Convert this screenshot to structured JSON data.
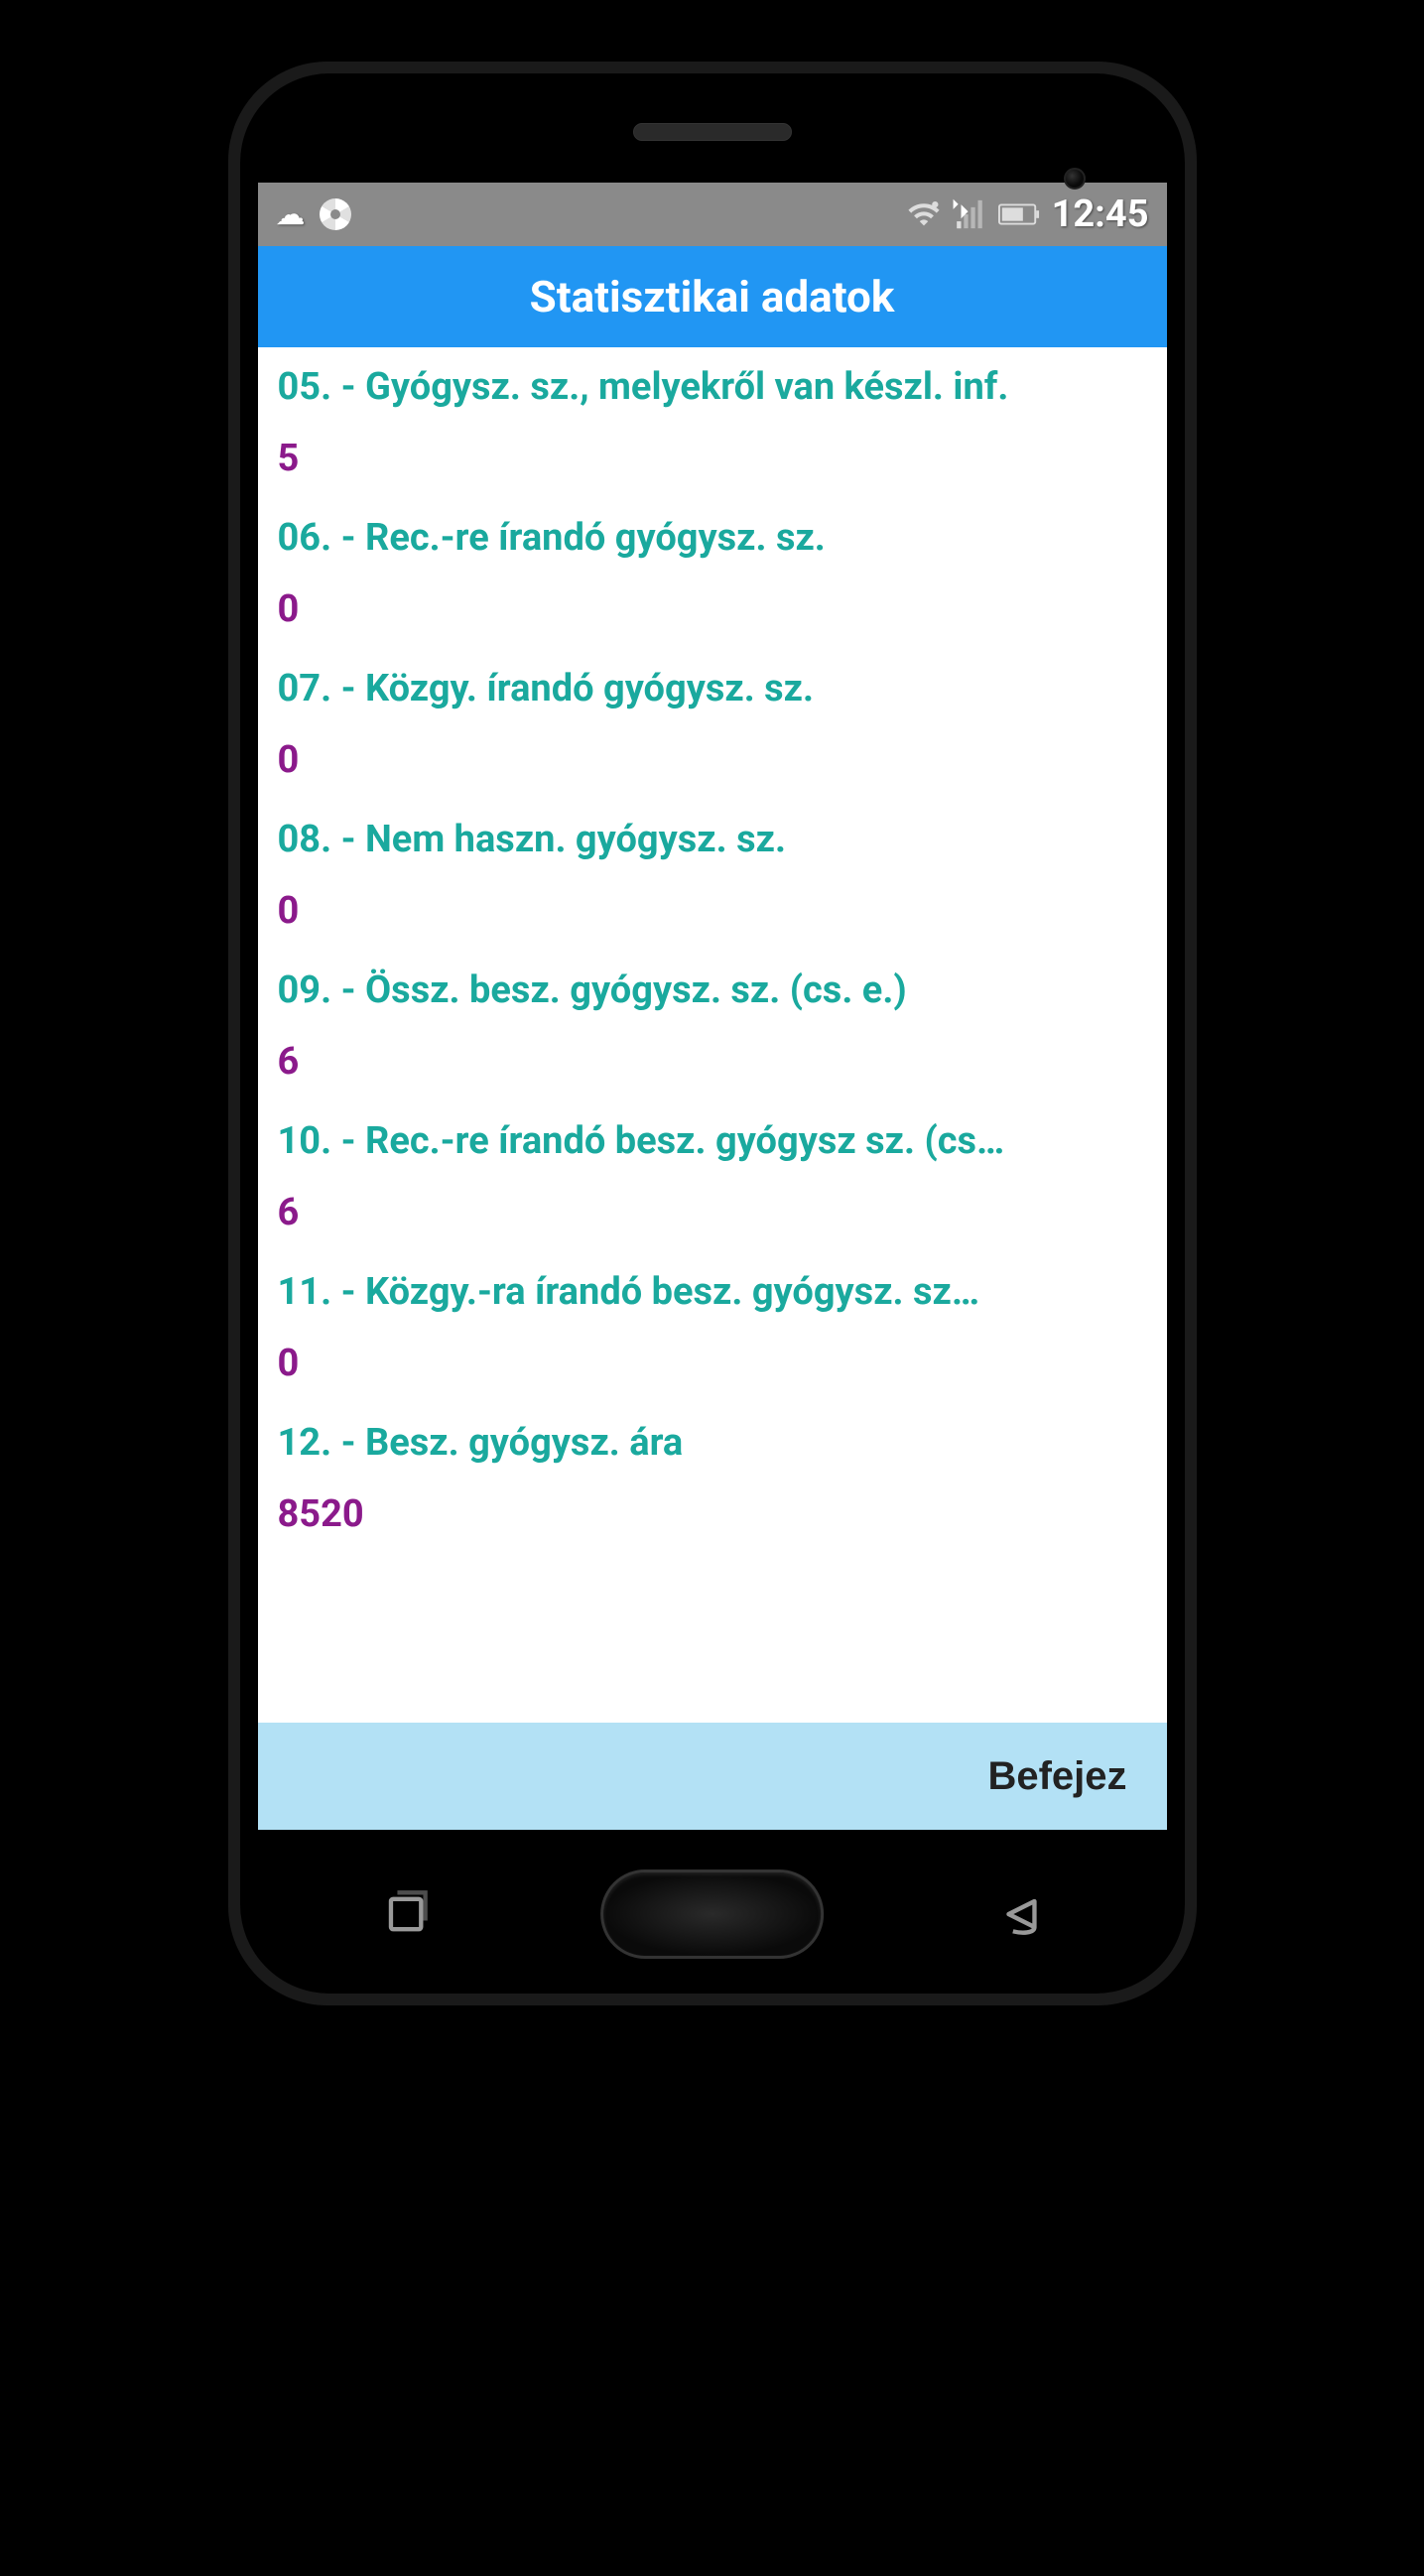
{
  "status_bar": {
    "clock": "12:45"
  },
  "app_bar": {
    "title": "Statisztikai adatok"
  },
  "stats": [
    {
      "label": "05. - Gyógysz. sz., melyekről van készl. inf.",
      "value": "5"
    },
    {
      "label": "06. - Rec.-re írandó gyógysz. sz.",
      "value": "0"
    },
    {
      "label": "07. - Közgy. írandó gyógysz. sz.",
      "value": "0"
    },
    {
      "label": "08. - Nem haszn. gyógysz. sz.",
      "value": "0"
    },
    {
      "label": "09. - Össz. besz. gyógysz. sz. (cs. e.)",
      "value": "6"
    },
    {
      "label": "10. - Rec.-re írandó besz. gyógysz sz. (cs…",
      "value": "6"
    },
    {
      "label": "11. - Közgy.-ra írandó besz. gyógysz. sz…",
      "value": "0"
    },
    {
      "label": "12. - Besz. gyógysz. ára",
      "value": "8520"
    }
  ],
  "bottom_bar": {
    "finish_label": "Befejez"
  }
}
